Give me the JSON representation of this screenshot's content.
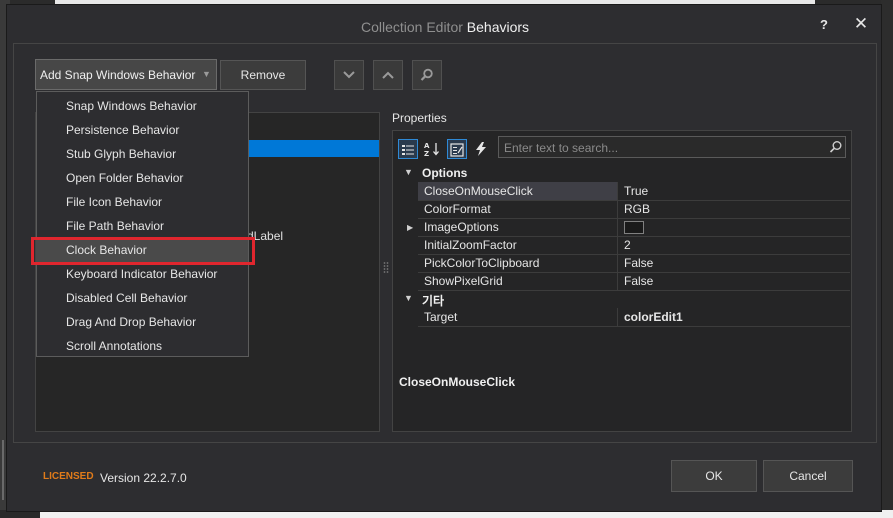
{
  "dialog": {
    "title_prefix": "Collection Editor",
    "title_name": "Behaviors",
    "help_label": "?",
    "close_label": "✕"
  },
  "toolbar": {
    "add_label": "Add Snap Windows Behavior",
    "remove_label": "Remove"
  },
  "members": {
    "partial_item_text": "dLabel"
  },
  "dropdown": {
    "items": [
      "Snap Windows Behavior",
      "Persistence Behavior",
      "Stub Glyph Behavior",
      "Open Folder Behavior",
      "File Icon Behavior",
      "File Path Behavior",
      "Clock Behavior",
      "Keyboard Indicator Behavior",
      "Disabled Cell Behavior",
      "Drag And Drop Behavior",
      "Scroll Annotations"
    ],
    "highlighted_item": "Clock Behavior"
  },
  "properties": {
    "label": "Properties",
    "search_placeholder": "Enter text to search...",
    "categories": [
      {
        "name": "Options",
        "rows": [
          {
            "name": "CloseOnMouseClick",
            "value": "True"
          },
          {
            "name": "ColorFormat",
            "value": "RGB"
          },
          {
            "name": "ImageOptions",
            "value": ""
          },
          {
            "name": "InitialZoomFactor",
            "value": "2"
          },
          {
            "name": "PickColorToClipboard",
            "value": "False"
          },
          {
            "name": "ShowPixelGrid",
            "value": "False"
          }
        ]
      },
      {
        "name": "기타",
        "rows": [
          {
            "name": "Target",
            "value": "colorEdit1"
          }
        ]
      }
    ],
    "description_title": "CloseOnMouseClick"
  },
  "footer": {
    "licensed": "LICENSED",
    "version": "Version 22.2.7.0",
    "ok_label": "OK",
    "cancel_label": "Cancel"
  },
  "colors": {
    "accent": "#0078d7",
    "license_orange": "#e07b1a",
    "highlight_border": "#e0262e"
  }
}
